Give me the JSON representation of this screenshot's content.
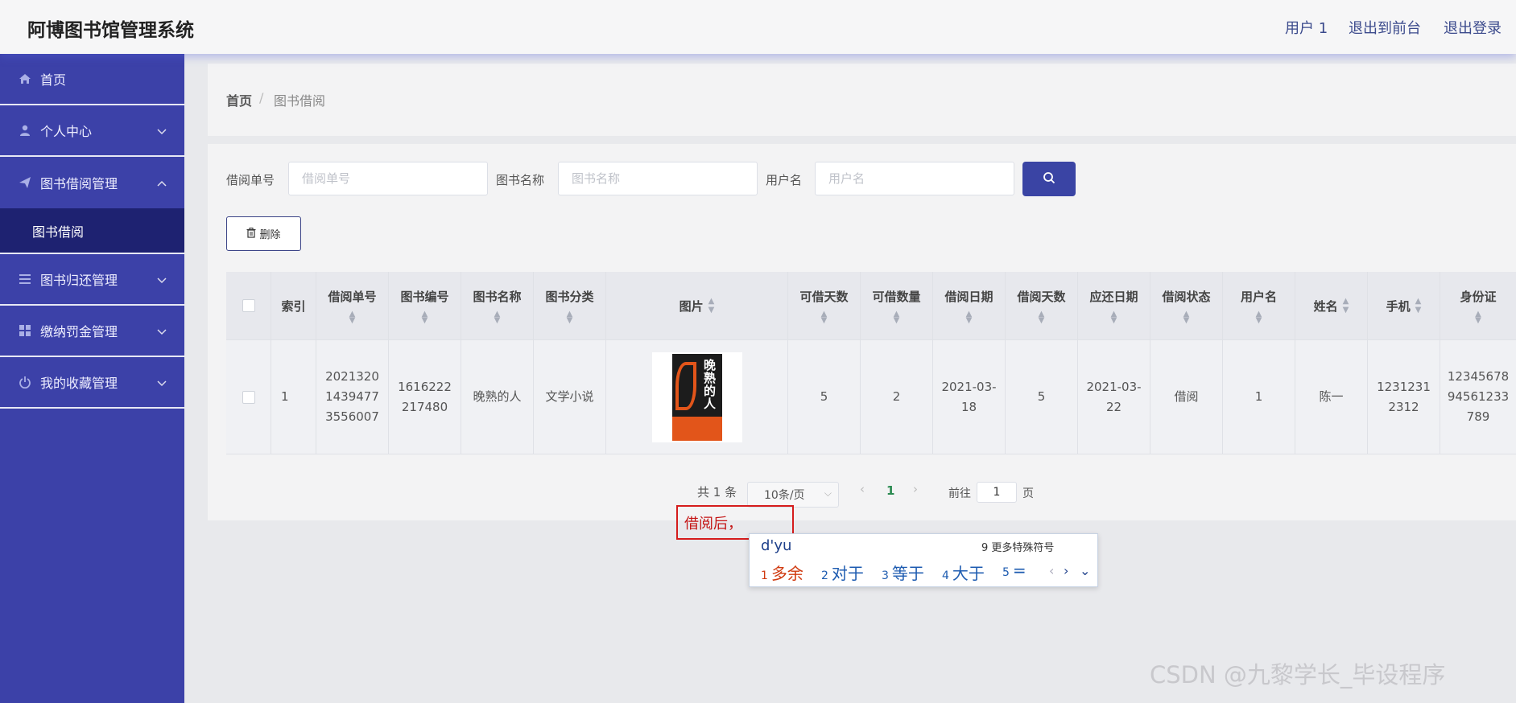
{
  "app": {
    "title": "阿博图书馆管理系统"
  },
  "header": {
    "user": "用户 1",
    "to_front": "退出到前台",
    "logout": "退出登录"
  },
  "sidebar": {
    "items": [
      {
        "label": "首页",
        "icon": "home-icon"
      },
      {
        "label": "个人中心",
        "icon": "user-icon"
      },
      {
        "label": "图书借阅管理",
        "icon": "send-icon"
      },
      {
        "label": "图书归还管理",
        "icon": "list-icon"
      },
      {
        "label": "缴纳罚金管理",
        "icon": "grid-icon"
      },
      {
        "label": "我的收藏管理",
        "icon": "power-icon"
      }
    ],
    "sub_item": "图书借阅"
  },
  "breadcrumb": {
    "home": "首页",
    "sep": "/",
    "current": "图书借阅"
  },
  "search": {
    "label1": "借阅单号",
    "ph1": "借阅单号",
    "label2": "图书名称",
    "ph2": "图书名称",
    "label3": "用户名",
    "ph3": "用户名"
  },
  "toolbar": {
    "delete_label": "删除"
  },
  "table": {
    "headers": {
      "index": "索引",
      "borrow_no": "借阅单号",
      "book_no": "图书编号",
      "book_name": "图书名称",
      "category": "图书分类",
      "image": "图片",
      "days_allowed": "可借天数",
      "qty": "可借数量",
      "borrow_date": "借阅日期",
      "borrow_days": "借阅天数",
      "due_date": "应还日期",
      "status": "借阅状态",
      "username": "用户名",
      "name": "姓名",
      "phone": "手机",
      "id_card": "身份证"
    },
    "row": {
      "index": "1",
      "borrow_no": "202132014394773556007",
      "book_no": "1616222217480",
      "book_name": "晚熟的人",
      "category": "文学小说",
      "days_allowed": "5",
      "qty": "2",
      "borrow_date": "2021-03-18",
      "borrow_days": "5",
      "due_date": "2021-03-22",
      "status": "借阅",
      "username": "1",
      "name": "陈一",
      "phone": "12312312312",
      "id_card": "1234567894561233789",
      "cover_title": "晚熟的人"
    }
  },
  "pagination": {
    "total": "共 1 条",
    "page_size": "10条/页",
    "current_page": "1",
    "goto": "前往",
    "goto_value": "1",
    "page_unit": "页"
  },
  "note": {
    "text": "借阅后，"
  },
  "ime": {
    "input": "d'yu",
    "more": "9 更多特殊符号",
    "candidates": [
      {
        "n": "1",
        "text": "多余"
      },
      {
        "n": "2",
        "text": "对于"
      },
      {
        "n": "3",
        "text": "等于"
      },
      {
        "n": "4",
        "text": "大于"
      },
      {
        "n": "5",
        "text": "="
      }
    ]
  },
  "watermark": "CSDN @九黎学长_毕设程序",
  "colors": {
    "sidebar": "#3c41a8",
    "sidebar_active": "#1e2271",
    "primary_button": "#3a44a4"
  }
}
